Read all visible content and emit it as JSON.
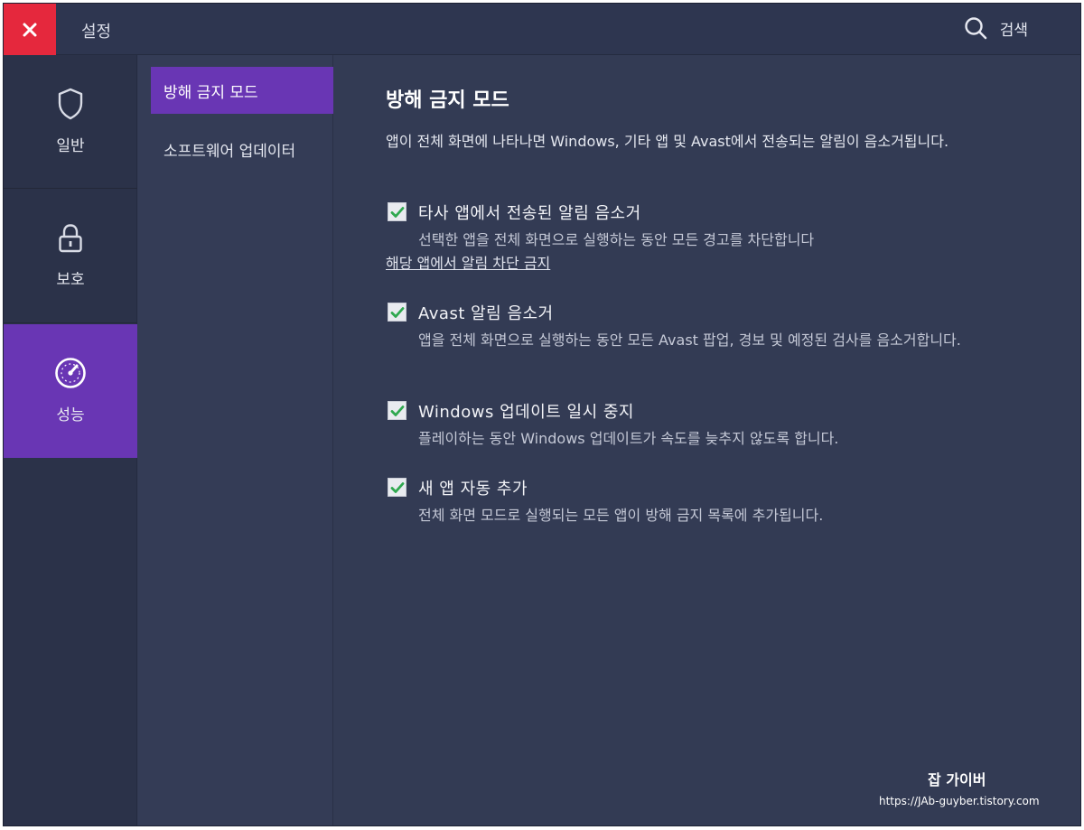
{
  "window": {
    "title": "설정",
    "search_label": "검색"
  },
  "nav": {
    "items": [
      {
        "label": "일반",
        "icon": "shield-icon"
      },
      {
        "label": "보호",
        "icon": "lock-icon"
      },
      {
        "label": "성능",
        "icon": "speedometer-icon",
        "active": true
      }
    ]
  },
  "subnav": {
    "items": [
      {
        "label": "방해 금지 모드",
        "active": true
      },
      {
        "label": "소프트웨어 업데이터"
      }
    ]
  },
  "content": {
    "heading": "방해 금지 모드",
    "description": "앱이 전체 화면에 나타나면 Windows, 기타 앱 및 Avast에서 전송되는 알림이 음소거됩니다.",
    "options": [
      {
        "title": "타사 앱에서 전송된 알림 음소거",
        "description": "선택한 앱을 전체 화면으로 실행하는 동안 모든 경고를 차단합니다",
        "link": "해당 앱에서 알림 차단 금지",
        "checked": true
      },
      {
        "title": "Avast 알림 음소거",
        "description": "앱을 전체 화면으로 실행하는 동안 모든 Avast 팝업, 경보 및 예정된 검사를 음소거합니다.",
        "checked": true
      },
      {
        "title": "Windows 업데이트 일시 중지",
        "description": "플레이하는 동안 Windows 업데이트가 속도를 늦추지 않도록 합니다.",
        "checked": true
      },
      {
        "title": "새 앱 자동 추가",
        "description": "전체 화면 모드로 실행되는 모든 앱이 방해 금지 목록에 추가됩니다.",
        "checked": true
      }
    ]
  },
  "watermark": {
    "title": "잡 가이버",
    "url": "https://JAb-guyber.tistory.com"
  },
  "colors": {
    "accent": "#6936b4",
    "close": "#e5283d",
    "check": "#2fa84f",
    "background": "#333b54"
  }
}
